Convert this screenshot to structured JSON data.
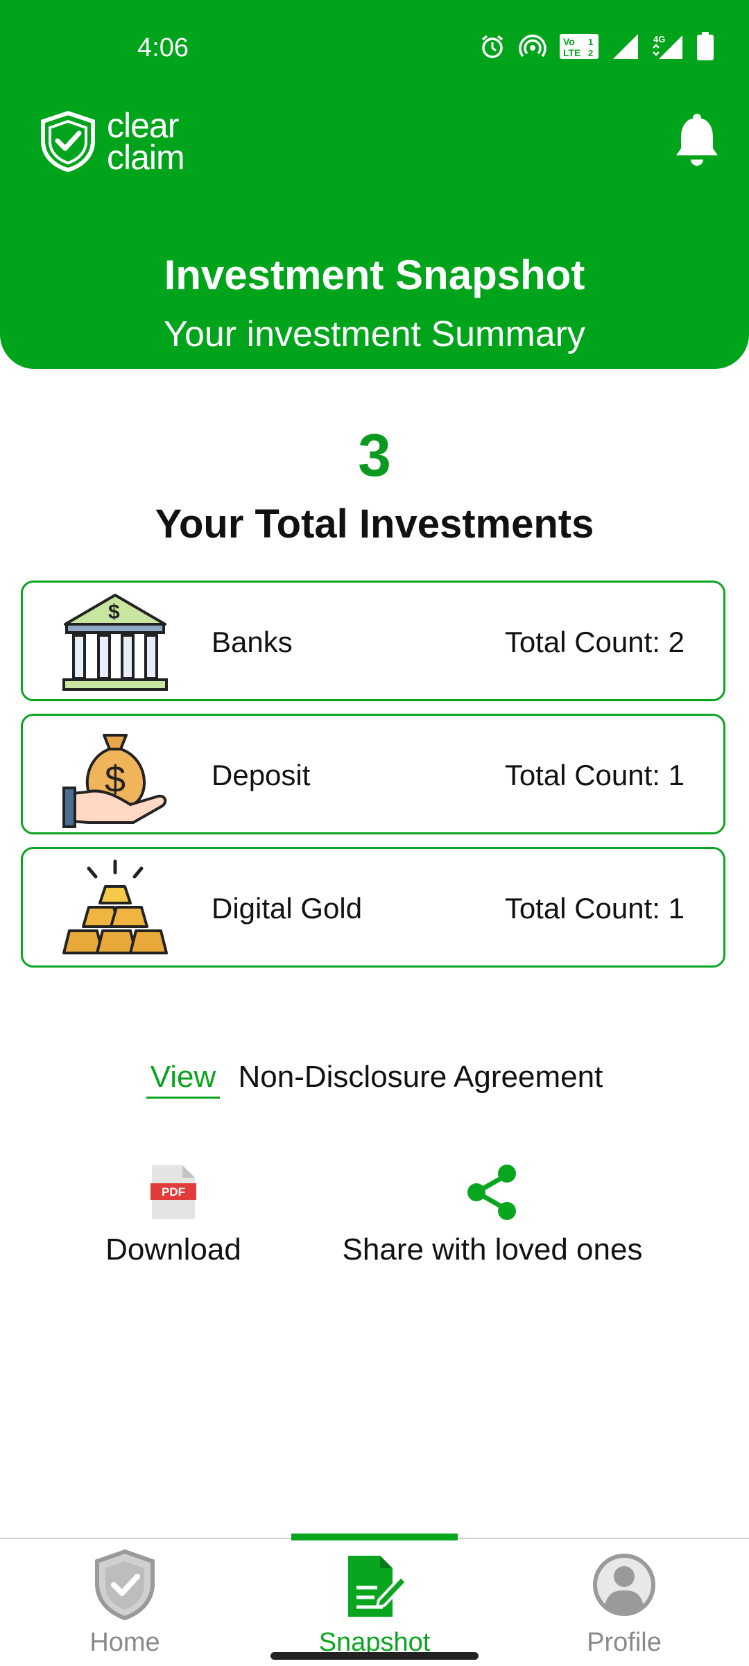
{
  "status_bar": {
    "time": "4:06",
    "icons": [
      "alarm-icon",
      "hotspot-icon",
      "volte-icon",
      "signal-icon",
      "4g-signal-icon",
      "battery-icon"
    ],
    "volte_text": "Vo LTE 2",
    "network_text": "4G"
  },
  "app": {
    "logo_line1": "clear",
    "logo_line2": "claim",
    "brand_color": "#00a41a"
  },
  "header": {
    "title": "Investment Snapshot",
    "subtitle": "Your investment Summary"
  },
  "summary": {
    "total_count": "3",
    "total_label": "Your Total Investments"
  },
  "investments": [
    {
      "name": "Banks",
      "count_text": "Total Count: 2",
      "icon": "bank-icon"
    },
    {
      "name": "Deposit",
      "count_text": "Total Count: 1",
      "icon": "money-bag-icon"
    },
    {
      "name": "Digital Gold",
      "count_text": "Total Count: 1",
      "icon": "gold-bars-icon"
    }
  ],
  "nda": {
    "view_label": "View",
    "text": "Non-Disclosure Agreement"
  },
  "actions": {
    "download_label": "Download",
    "pdf_badge": "PDF",
    "share_label": "Share with loved ones"
  },
  "bottom_nav": {
    "items": [
      {
        "label": "Home",
        "icon": "shield-check-icon",
        "active": false
      },
      {
        "label": "Snapshot",
        "icon": "document-edit-icon",
        "active": true
      },
      {
        "label": "Profile",
        "icon": "user-icon",
        "active": false
      }
    ]
  }
}
